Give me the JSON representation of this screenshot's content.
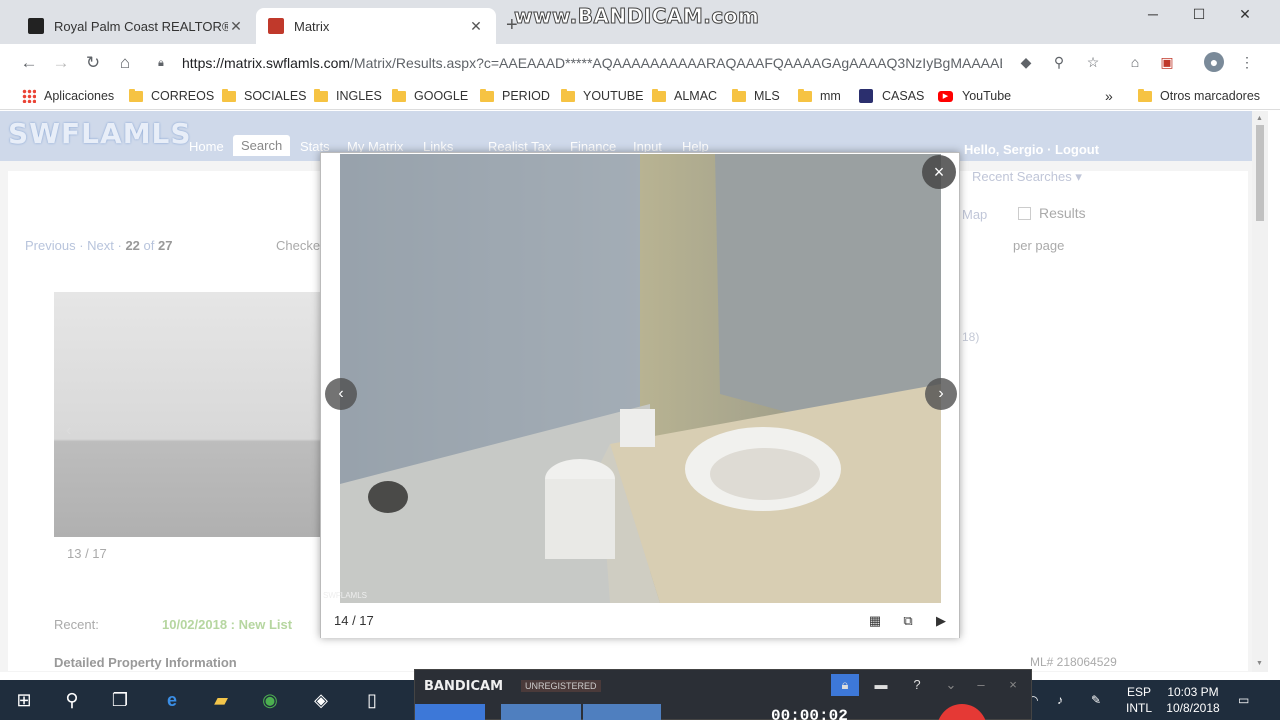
{
  "browser": {
    "tabs": [
      {
        "title": "Royal Palm Coast REALTOR® Ass",
        "active": false,
        "favicon_color": "#222222"
      },
      {
        "title": "Matrix",
        "active": true,
        "favicon_color": "#c0392b"
      }
    ],
    "watermark": "www.BANDICAM.com",
    "url_host": "https://matrix.swflamls.com",
    "url_path": "/Matrix/Results.aspx?c=AAEAAAD*****AQAAAAAAAAAARAQAAAFQAAAAGAgAAAAQ3NzIyBgMAAAABM...",
    "bookmarks": [
      {
        "label": "Aplicaciones",
        "icon": "apps-icon"
      },
      {
        "label": "CORREOS",
        "icon": "folder-icon"
      },
      {
        "label": "SOCIALES",
        "icon": "folder-icon"
      },
      {
        "label": "INGLES",
        "icon": "folder-icon"
      },
      {
        "label": "GOOGLE",
        "icon": "folder-icon"
      },
      {
        "label": "PERIOD",
        "icon": "folder-icon"
      },
      {
        "label": "YOUTUBE",
        "icon": "folder-icon"
      },
      {
        "label": "ALMAC",
        "icon": "folder-icon"
      },
      {
        "label": "MLS",
        "icon": "folder-icon"
      },
      {
        "label": "mm",
        "icon": "folder-icon"
      },
      {
        "label": "CASAS",
        "icon": "casas-icon"
      },
      {
        "label": "YouTube",
        "icon": "youtube-icon"
      }
    ],
    "more": "»",
    "other_bookmarks": "Otros marcadores"
  },
  "mls": {
    "logo": "SWFLAMLS",
    "nav": [
      "Home",
      "Search",
      "Stats",
      "My Matrix",
      "Links",
      "Realist Tax",
      "Finance",
      "Input",
      "Help"
    ],
    "greeting": "Hello, Sergio · Logout",
    "recent_searches": "Recent Searches ▾",
    "map": "Map",
    "results": "Results",
    "pager": {
      "prev": "Previous",
      "next": "Next",
      "current": "22",
      "of_label": "of",
      "total": "27"
    },
    "checked": "Checke",
    "per_page": "per page",
    "side_count": "18)",
    "bg_photo_count": "13 / 17",
    "recent_label": "Recent:",
    "recent_value": "10/02/2018 : New List",
    "detailed": "Detailed Property Information",
    "mls_number": "ML# 218064529"
  },
  "lightbox": {
    "counter": "14 / 17",
    "copyright": "SWFLAMLS",
    "close": "×",
    "prev": "‹",
    "next": "›"
  },
  "bandicam": {
    "logo": "BANDICAM",
    "status": "UNREGISTERED",
    "timer": "00:00:02",
    "help": "?",
    "minimize": "–",
    "close": "×"
  },
  "taskbar": {
    "language": "ESP",
    "layout": "INTL",
    "time": "10:03 PM",
    "date": "10/8/2018"
  },
  "colors": {
    "taskbar": "#1f2d3d",
    "mls_header": "#cfd9ea",
    "bandicam_accent": "#3d78d8",
    "record": "#e53935"
  }
}
